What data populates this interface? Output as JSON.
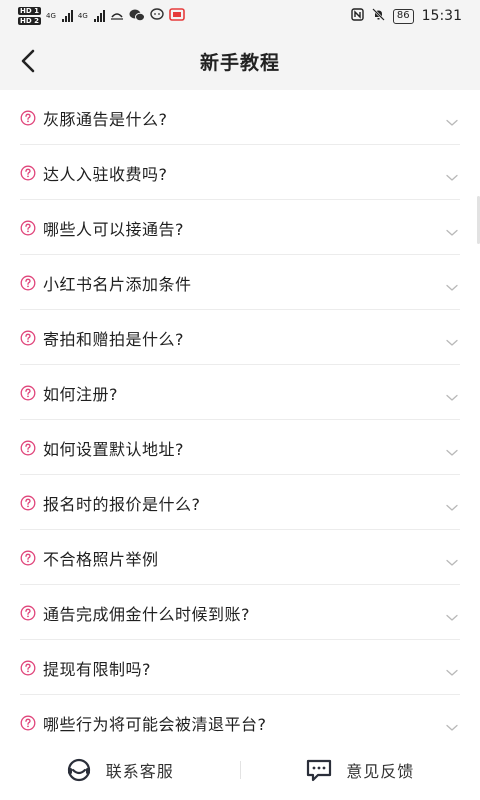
{
  "status_bar": {
    "sim1": "HD 1",
    "sim2": "HD 2",
    "net1": "4G",
    "net2": "4G",
    "battery": "86",
    "time": "15:31"
  },
  "header": {
    "title": "新手教程"
  },
  "faq": {
    "items": [
      {
        "label": "灰豚通告是什么?"
      },
      {
        "label": "达人入驻收费吗?"
      },
      {
        "label": "哪些人可以接通告?"
      },
      {
        "label": "小红书名片添加条件"
      },
      {
        "label": "寄拍和赠拍是什么?"
      },
      {
        "label": "如何注册?"
      },
      {
        "label": "如何设置默认地址?"
      },
      {
        "label": "报名时的报价是什么?"
      },
      {
        "label": "不合格照片举例"
      },
      {
        "label": "通告完成佣金什么时候到账?"
      },
      {
        "label": "提现有限制吗?"
      },
      {
        "label": "哪些行为将可能会被清退平台?"
      }
    ]
  },
  "bottom_bar": {
    "contact_label": "联系客服",
    "feedback_label": "意见反馈"
  },
  "colors": {
    "accent": "#e0457b",
    "text": "#1f1f1f",
    "header_bg": "#f4f4f4"
  }
}
